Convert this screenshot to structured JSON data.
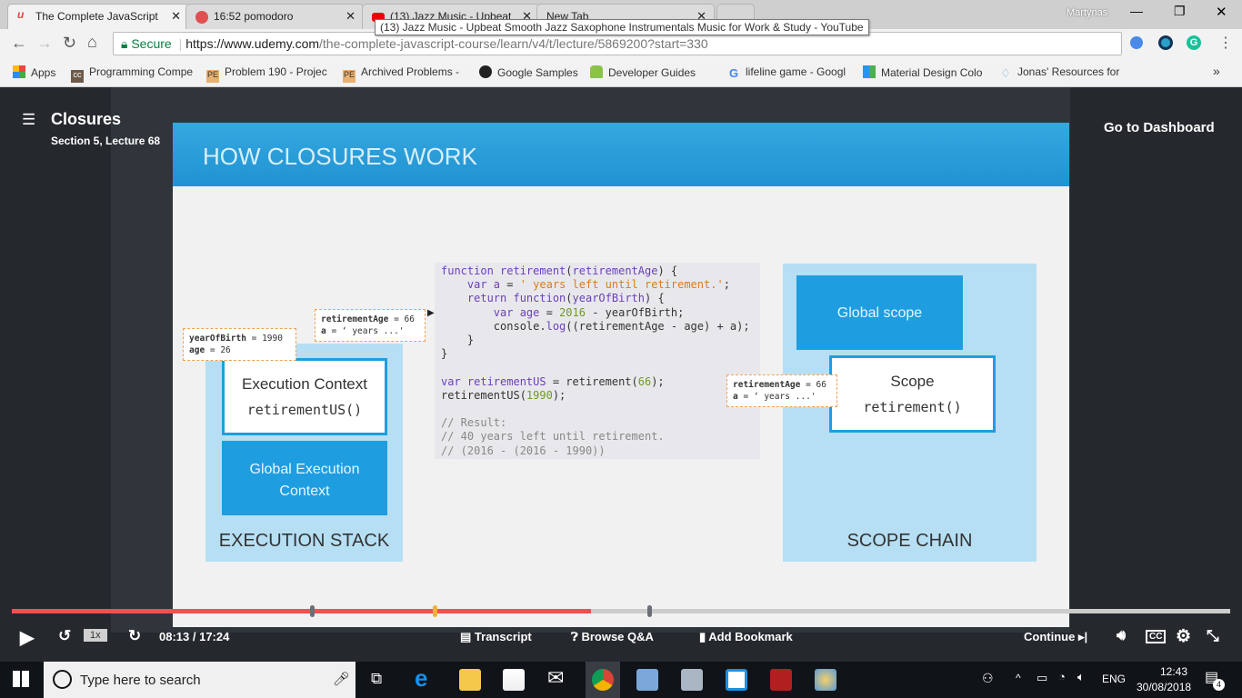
{
  "browser": {
    "tabs": [
      {
        "title": "The Complete JavaScript",
        "active": true
      },
      {
        "title": "16:52 pomodoro"
      },
      {
        "title": "(13) Jazz Music - Upbeat"
      },
      {
        "title": "New Tab"
      }
    ],
    "tooltip": "(13) Jazz Music - Upbeat Smooth Jazz Saxophone Instrumentals Music for Work & Study - YouTube",
    "profile": "Martynas",
    "secure_label": "Secure",
    "url_host": "https://www.udemy.com",
    "url_path": "/the-complete-javascript-course/learn/v4/t/lecture/5869200?start=330",
    "bookmarks": [
      "Apps",
      "Programming Compe",
      "Problem 190 - Projec",
      "Archived Problems - ",
      "Google Samples",
      "Developer Guides",
      "lifeline game - Googl",
      "Material Design Colo",
      "Jonas' Resources for "
    ],
    "more": "»"
  },
  "lecture": {
    "title": "Closures",
    "subtitle": "Section 5, Lecture 68",
    "dashboard": "Go to Dashboard"
  },
  "slide": {
    "heading": "HOW CLOSURES WORK",
    "note_birth": [
      "yearOfBirth",
      " = 1990",
      "age",
      " = 26"
    ],
    "note_ret": [
      "retirementAge",
      " = 66",
      "a",
      " = ‘ years ...'"
    ],
    "exec_context": "Execution Context",
    "exec_fn": "retirementUS()",
    "global_exec": "Global Execution Context",
    "exec_stack": "EXECUTION STACK",
    "global_scope": "Global scope",
    "scope": "Scope",
    "scope_fn": "retirement()",
    "scope_chain": "SCOPE CHAIN"
  },
  "player": {
    "progress_percent": 47.5,
    "speed": "1x",
    "time": "08:13 / 17:24",
    "transcript": "Transcript",
    "qa": "Browse Q&A",
    "bookmark": "Add Bookmark",
    "continue": "Continue",
    "cc": "CC"
  },
  "taskbar": {
    "search_placeholder": "Type here to search",
    "lang": "ENG",
    "time": "12:43",
    "date": "30/08/2018",
    "notifications": "4"
  }
}
